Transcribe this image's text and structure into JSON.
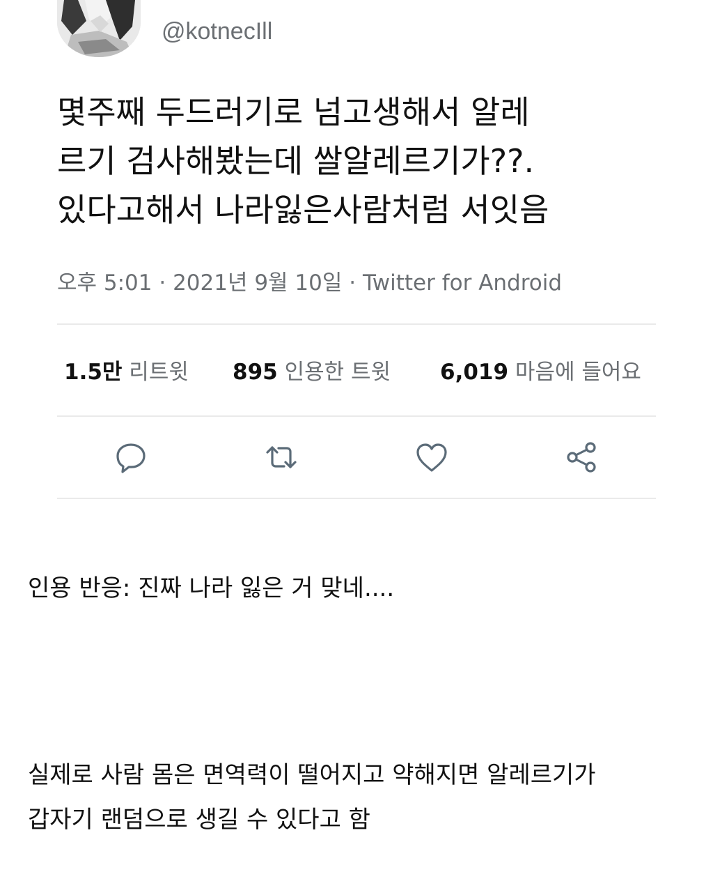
{
  "tweet": {
    "handle": "@kotnecIll",
    "text_lines": [
      "몇주째 두드러기로 넘고생해서 알레",
      "르기 검사해봤는데 쌀알레르기가??.",
      "있다고해서 나라잃은사람처럼 서잇음"
    ],
    "meta": "오후 5:01 · 2021년 9월 10일 · Twitter for Android",
    "stats": {
      "retweets": {
        "value": "1.5만",
        "label": "리트윗"
      },
      "quotes": {
        "value": "895",
        "label": "인용한 트윗"
      },
      "likes": {
        "value": "6,019",
        "label": "마음에 들어요"
      }
    },
    "actions": [
      "reply-icon",
      "retweet-icon",
      "heart-icon",
      "share-icon"
    ]
  },
  "body": {
    "quote_reaction": "인용 반응: 진짜 나라 잃은 거 맞네....",
    "explanation_lines": [
      "실제로 사람 몸은 면역력이 떨어지고 약해지면 알레르기가",
      "갑자기 랜덤으로 생길 수 있다고 함"
    ]
  },
  "colors": {
    "text": "#111111",
    "muted": "#6b6f73",
    "divider": "#eaeaea",
    "icon": "#5b6b78"
  }
}
